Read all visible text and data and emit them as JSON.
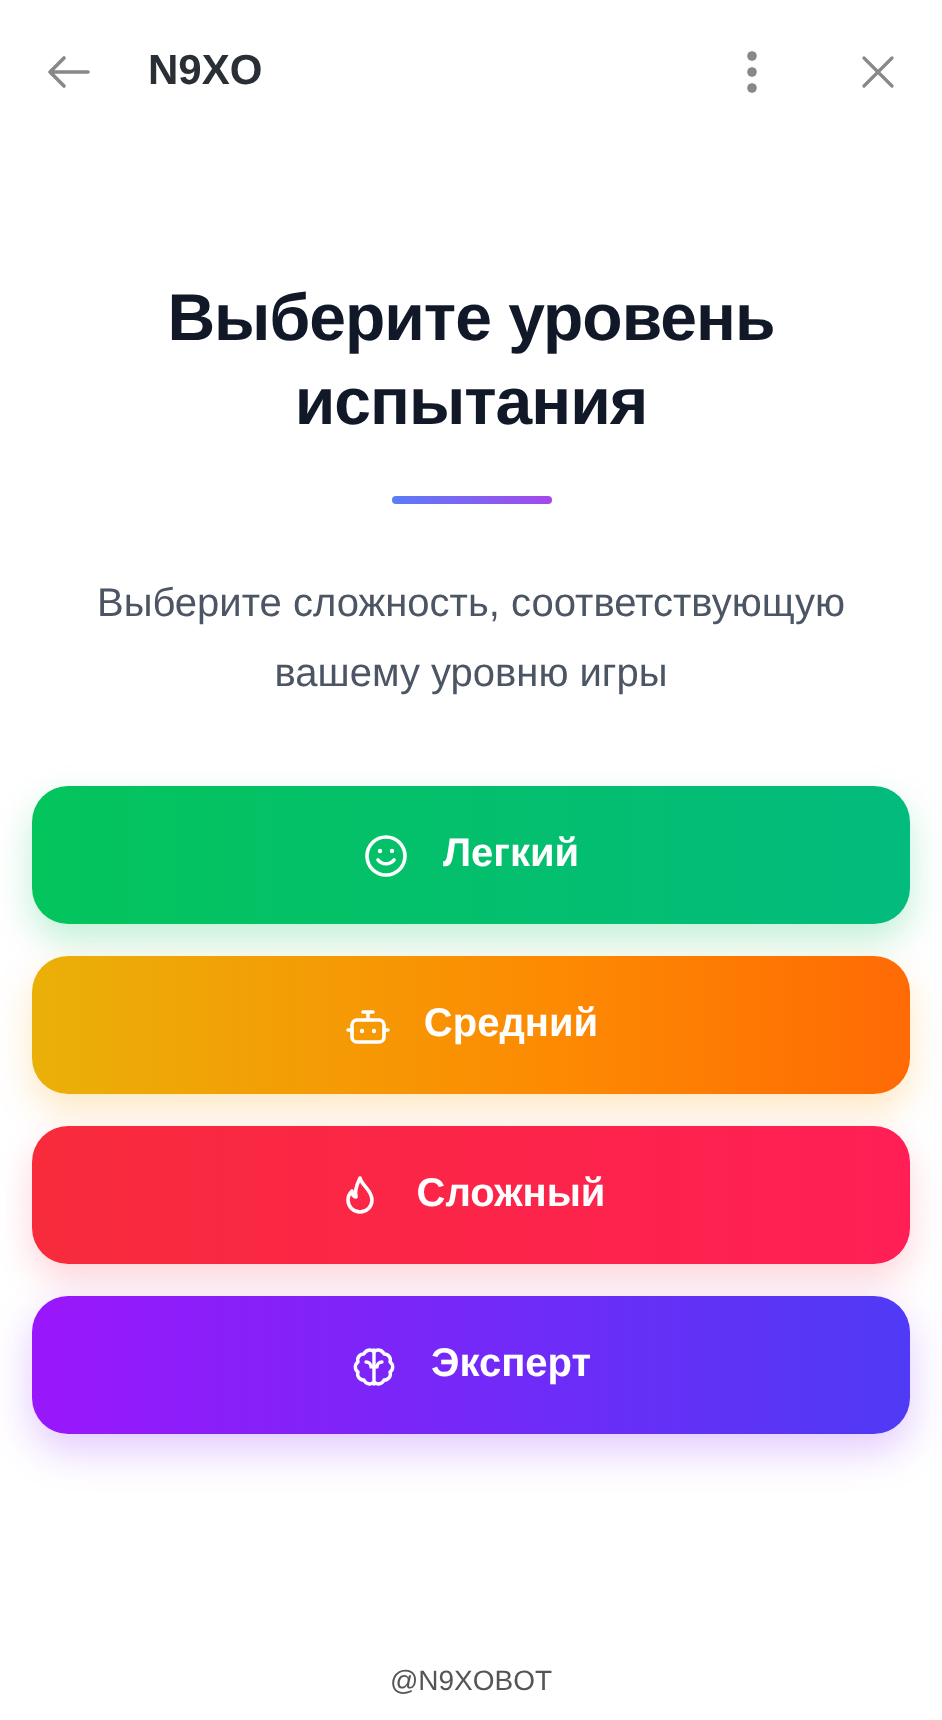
{
  "header": {
    "title": "N9XO"
  },
  "heading": "Выберите уровень испытания",
  "subtitle": "Выберите сложность, соответствующую вашему уровню игры",
  "levels": [
    {
      "label": "Легкий",
      "kind": "easy"
    },
    {
      "label": "Средний",
      "kind": "medium"
    },
    {
      "label": "Сложный",
      "kind": "hard"
    },
    {
      "label": "Эксперт",
      "kind": "expert"
    }
  ],
  "footer": "@N9XOBOT"
}
